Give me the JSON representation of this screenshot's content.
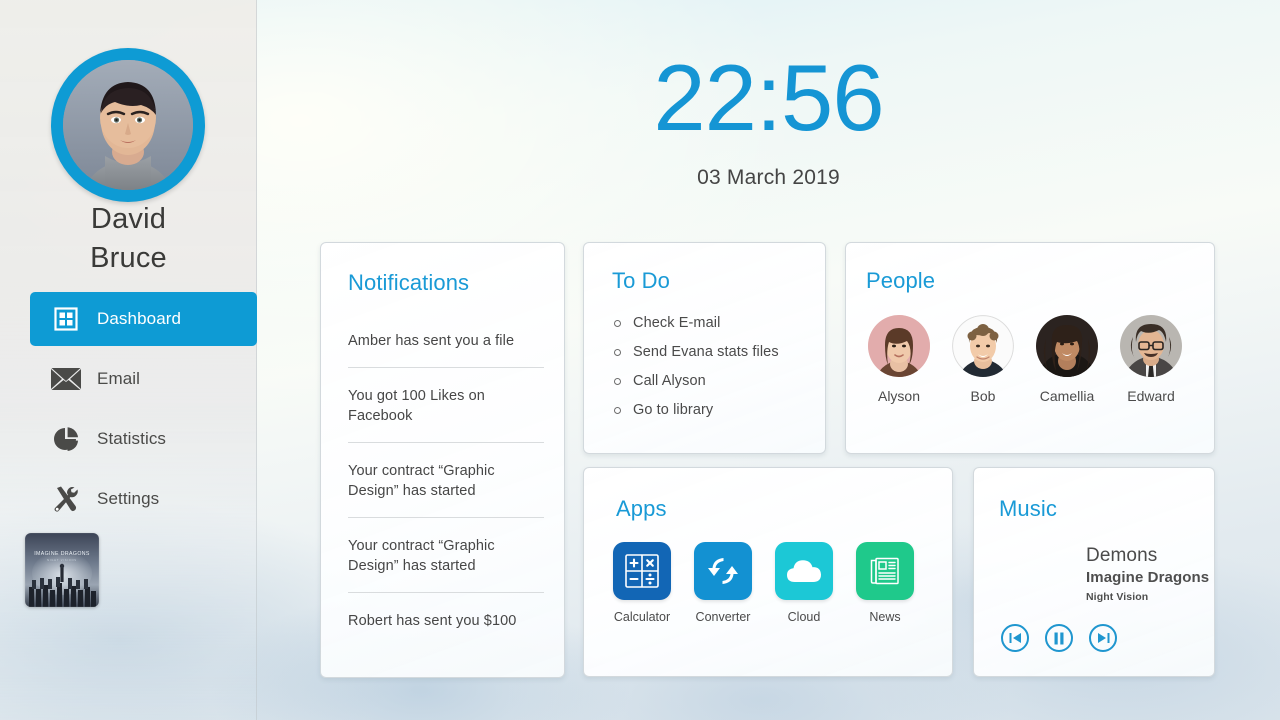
{
  "accent_color": "#0e9bd4",
  "clock": {
    "time": "22:56",
    "date": "03 March 2019"
  },
  "sidebar": {
    "user": {
      "first_name": "David",
      "last_name": "Bruce",
      "avatar_label": "user-avatar"
    },
    "items": [
      {
        "label": "Dashboard",
        "icon": "grid-icon",
        "active": true
      },
      {
        "label": "Email",
        "icon": "envelope-icon",
        "active": false
      },
      {
        "label": "Statistics",
        "icon": "pie-chart-icon",
        "active": false
      },
      {
        "label": "Settings",
        "icon": "tools-icon",
        "active": false
      }
    ]
  },
  "notifications": {
    "title": "Notifications",
    "items": [
      "Amber has sent you a file",
      "You got 100 Likes on Facebook",
      "Your contract “Graphic Design” has started",
      "Your contract “Graphic Design” has started",
      "Robert has sent you $100"
    ]
  },
  "todo": {
    "title": "To Do",
    "items": [
      "Check E-mail",
      "Send Evana stats files",
      "Call Alyson",
      "Go to library"
    ]
  },
  "people": {
    "title": "People",
    "items": [
      {
        "name": "Alyson"
      },
      {
        "name": "Bob"
      },
      {
        "name": "Camellia"
      },
      {
        "name": "Edward"
      }
    ]
  },
  "apps": {
    "title": "Apps",
    "items": [
      {
        "name": "Calculator",
        "icon": "calculator-icon",
        "color": "#1266b5"
      },
      {
        "name": "Converter",
        "icon": "convert-arrows-icon",
        "color": "#1391d2"
      },
      {
        "name": "Cloud",
        "icon": "cloud-icon",
        "color": "#1cc8d6"
      },
      {
        "name": "News",
        "icon": "newspaper-icon",
        "color": "#1fc98b"
      }
    ]
  },
  "music": {
    "title": "Music",
    "track": "Demons",
    "artist": "Imagine Dragons",
    "album": "Night Vision",
    "album_art_label": "night-visions-album-cover",
    "controls": [
      {
        "name": "previous-button",
        "icon": "skip-back-icon"
      },
      {
        "name": "pause-button",
        "icon": "pause-icon"
      },
      {
        "name": "next-button",
        "icon": "skip-forward-icon"
      }
    ]
  }
}
